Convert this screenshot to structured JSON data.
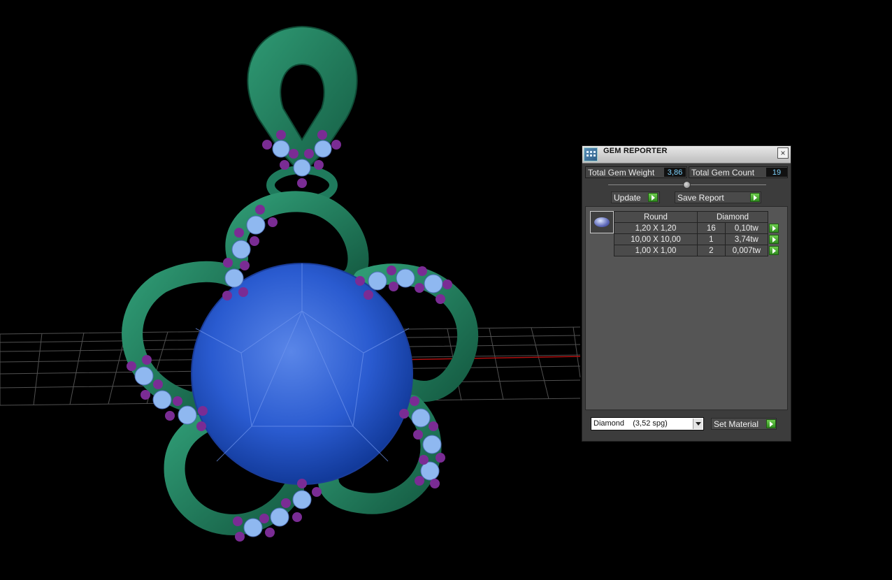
{
  "panel": {
    "title": "GEM REPORTER",
    "close_glyph": "×",
    "total_weight_label": "Total Gem Weight",
    "total_weight_value": "3,86",
    "total_count_label": "Total Gem Count",
    "total_count_value": "19",
    "update_label": "Update",
    "save_report_label": "Save Report",
    "table": {
      "shape_header": "Round",
      "material_header": "Diamond",
      "rows": [
        {
          "size": "1,20 X 1,20",
          "count": "16",
          "weight": "0,10tw"
        },
        {
          "size": "10,00 X 10,00",
          "count": "1",
          "weight": "3,74tw"
        },
        {
          "size": "1,00 X 1,00",
          "count": "2",
          "weight": "0,007tw"
        }
      ]
    },
    "material_select": "Diamond    (3,52 spg)",
    "set_material_label": "Set Material"
  },
  "colors": {
    "metal": "#1f7a5c",
    "center_gem": "#2a5bd0",
    "accent_stone": "#8fb8f0",
    "prong": "#6a2a8c",
    "grid": "#5a5a5a",
    "axis": "#b01010"
  }
}
